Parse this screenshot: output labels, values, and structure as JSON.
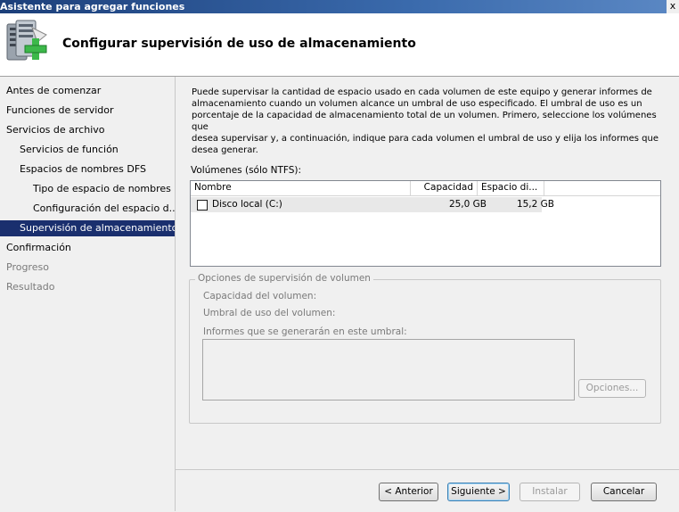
{
  "window": {
    "title": "Asistente para agregar funciones",
    "close_glyph": "x"
  },
  "header": {
    "title": "Configurar supervisión de uso de almacenamiento",
    "icon": "server-add-icon"
  },
  "sidebar": {
    "items": [
      {
        "label": "Antes de comenzar",
        "state": "normal"
      },
      {
        "label": "Funciones de servidor",
        "state": "normal"
      },
      {
        "label": "Servicios de archivo",
        "state": "normal"
      },
      {
        "label": "Servicios de función",
        "state": "normal"
      },
      {
        "label": "Espacios de nombres DFS",
        "state": "normal"
      },
      {
        "label": "Tipo de espacio de nombres",
        "state": "normal"
      },
      {
        "label": "Configuración del espacio d...",
        "state": "normal"
      },
      {
        "label": "Supervisión de almacenamiento",
        "state": "selected"
      },
      {
        "label": "Confirmación",
        "state": "normal"
      },
      {
        "label": "Progreso",
        "state": "disabled"
      },
      {
        "label": "Resultado",
        "state": "disabled"
      }
    ]
  },
  "main": {
    "intro_lines": [
      "Puede supervisar la cantidad de espacio usado en cada volumen de este equipo y generar informes de",
      "almacenamiento cuando un volumen alcance un umbral de uso especificado. El umbral de uso es un",
      "porcentaje de la capacidad de almacenamiento total de un volumen. Primero, seleccione los volúmenes que",
      "desea supervisar y, a continuación, indique para cada volumen el umbral de uso y elija los informes que",
      "desea generar."
    ],
    "volumes_label": "Volúmenes (sólo NTFS):",
    "columns": [
      "Nombre",
      "Capacidad",
      "Espacio di..."
    ],
    "rows": [
      {
        "name": "Disco local (C:)",
        "capacity": "25,0 GB",
        "free": "15,2 GB",
        "checked": false
      }
    ],
    "options": {
      "legend": "Opciones de supervisión de volumen",
      "capacity_label": "Capacidad del volumen:",
      "threshold_label": "Umbral de uso del volumen:",
      "reports_label": "Informes que se generarán en este umbral:",
      "options_button": "Opciones..."
    }
  },
  "footer": {
    "back": "< Anterior",
    "next": "Siguiente >",
    "install": "Instalar",
    "cancel": "Cancelar"
  },
  "colors": {
    "selected_bg": "#1a2f6e",
    "title_bar": "#1c3f7a",
    "disabled_text": "#7a7a7a"
  }
}
